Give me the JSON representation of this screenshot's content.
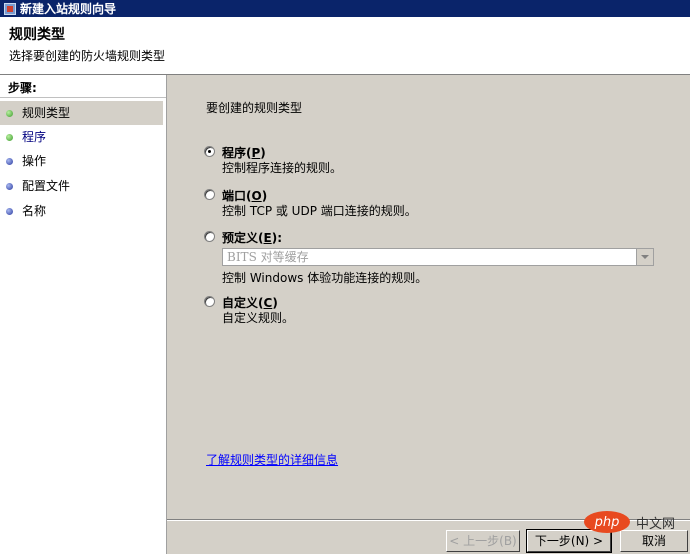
{
  "window": {
    "title": "新建入站规则向导"
  },
  "header": {
    "title": "规则类型",
    "subtitle": "选择要创建的防火墙规则类型"
  },
  "sidebar": {
    "steps_title": "步骤:",
    "items": [
      {
        "label": "规则类型",
        "state": "current"
      },
      {
        "label": "程序",
        "state": "link"
      },
      {
        "label": "操作",
        "state": "pending"
      },
      {
        "label": "配置文件",
        "state": "pending"
      },
      {
        "label": "名称",
        "state": "pending"
      }
    ]
  },
  "main": {
    "prompt": "要创建的规则类型",
    "options": [
      {
        "title": "程序",
        "accel": "P",
        "desc": "控制程序连接的规则。",
        "checked": true
      },
      {
        "title": "端口",
        "accel": "O",
        "desc": "控制 TCP 或 UDP 端口连接的规则。",
        "checked": false
      },
      {
        "title": "预定义",
        "accel": "E",
        "desc": "控制 Windows 体验功能连接的规则。",
        "checked": false
      },
      {
        "title": "自定义",
        "accel": "C",
        "desc": "自定义规则。",
        "checked": false
      }
    ],
    "predefined_select": {
      "value": "BITS 对等缓存"
    },
    "help_link": "了解规则类型的详细信息"
  },
  "footer": {
    "back": "< 上一步(B)",
    "next": "下一步(N) >",
    "cancel": "取消"
  },
  "watermark": {
    "logo": "php",
    "text": "中文网"
  }
}
